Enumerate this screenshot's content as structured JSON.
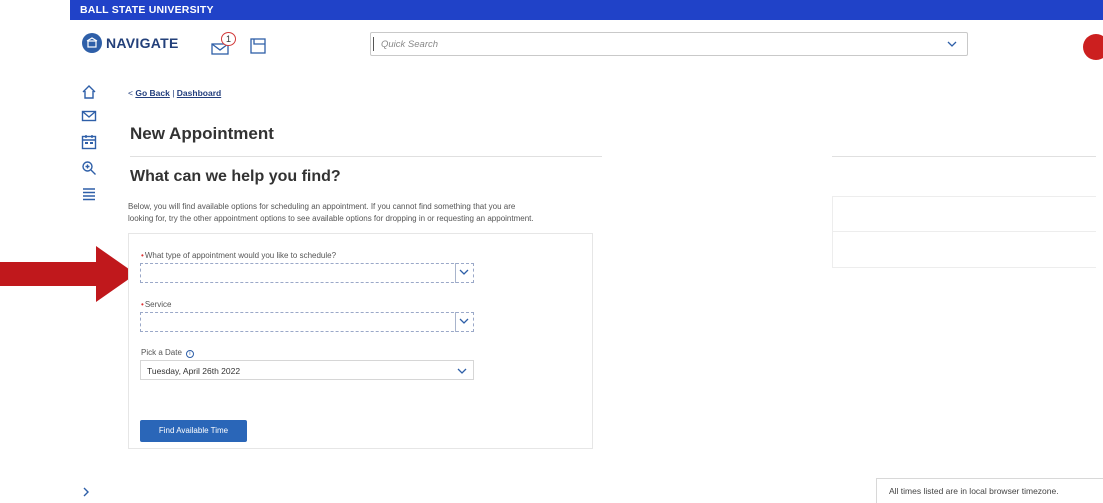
{
  "university_bar": {
    "text": "BALL STATE UNIVERSITY"
  },
  "header": {
    "logo_text": "NAVIGATE",
    "message_badge": "1",
    "search_placeholder": "Quick Search"
  },
  "breadcrumb": {
    "back": "Go Back",
    "separator": "|",
    "dashboard": "Dashboard"
  },
  "page": {
    "title": "New Appointment",
    "section_title": "What can we help you find?",
    "intro_line1": "Below, you will find available options for scheduling an appointment. If you cannot find something that you are",
    "intro_line2": "looking for, try the other appointment options to see available options for dropping in or requesting an appointment."
  },
  "form": {
    "appointment_type_label": "What type of appointment would you like to schedule?",
    "appointment_type_value": "",
    "service_label": "Service",
    "service_value": "",
    "date_label": "Pick a Date",
    "date_value": "Tuesday, April 26th 2022",
    "find_button": "Find Available Time"
  },
  "footer": {
    "timezone_note": "All times listed are in local browser timezone."
  },
  "colors": {
    "brand_blue": "#2042c8",
    "button_blue": "#2a66b8",
    "arrow_red": "#c0181c",
    "required_red": "#d33333"
  }
}
